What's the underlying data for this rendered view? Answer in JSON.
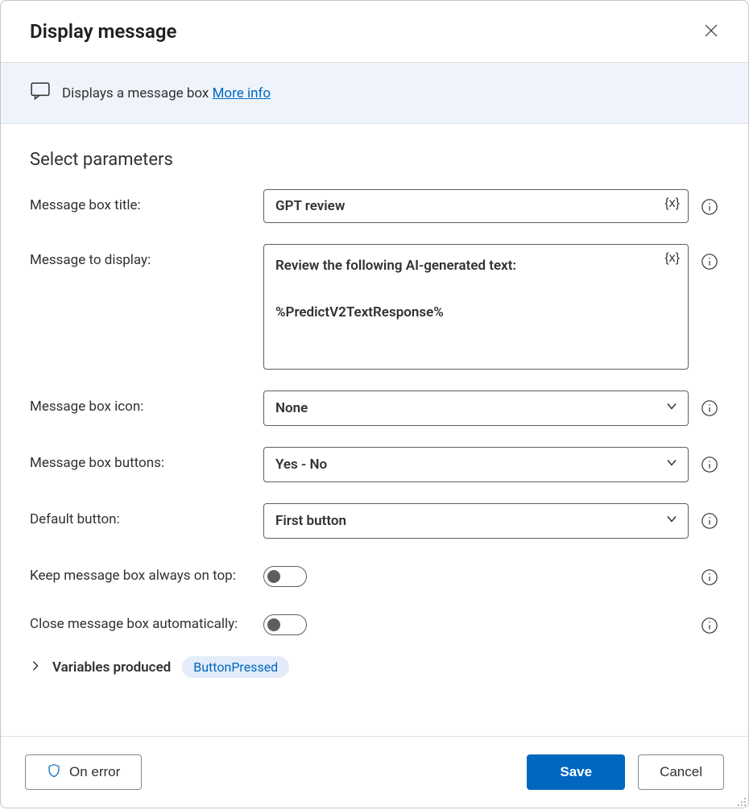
{
  "header": {
    "title": "Display message"
  },
  "banner": {
    "text": "Displays a message box ",
    "link_label": "More info"
  },
  "section_title": "Select parameters",
  "fields": {
    "title_label": "Message box title:",
    "title_value": "GPT review",
    "message_label": "Message to display:",
    "message_value": "Review the following AI-generated text:\n\n%PredictV2TextResponse%",
    "icon_label": "Message box icon:",
    "icon_value": "None",
    "buttons_label": "Message box buttons:",
    "buttons_value": "Yes - No",
    "default_label": "Default button:",
    "default_value": "First button",
    "ontop_label": "Keep message box always on top:",
    "ontop_value": false,
    "autoclose_label": "Close message box automatically:",
    "autoclose_value": false
  },
  "variables_produced": {
    "label": "Variables produced",
    "items": [
      "ButtonPressed"
    ]
  },
  "footer": {
    "on_error": "On error",
    "save": "Save",
    "cancel": "Cancel"
  },
  "icons": {
    "variable_token": "{x}"
  }
}
